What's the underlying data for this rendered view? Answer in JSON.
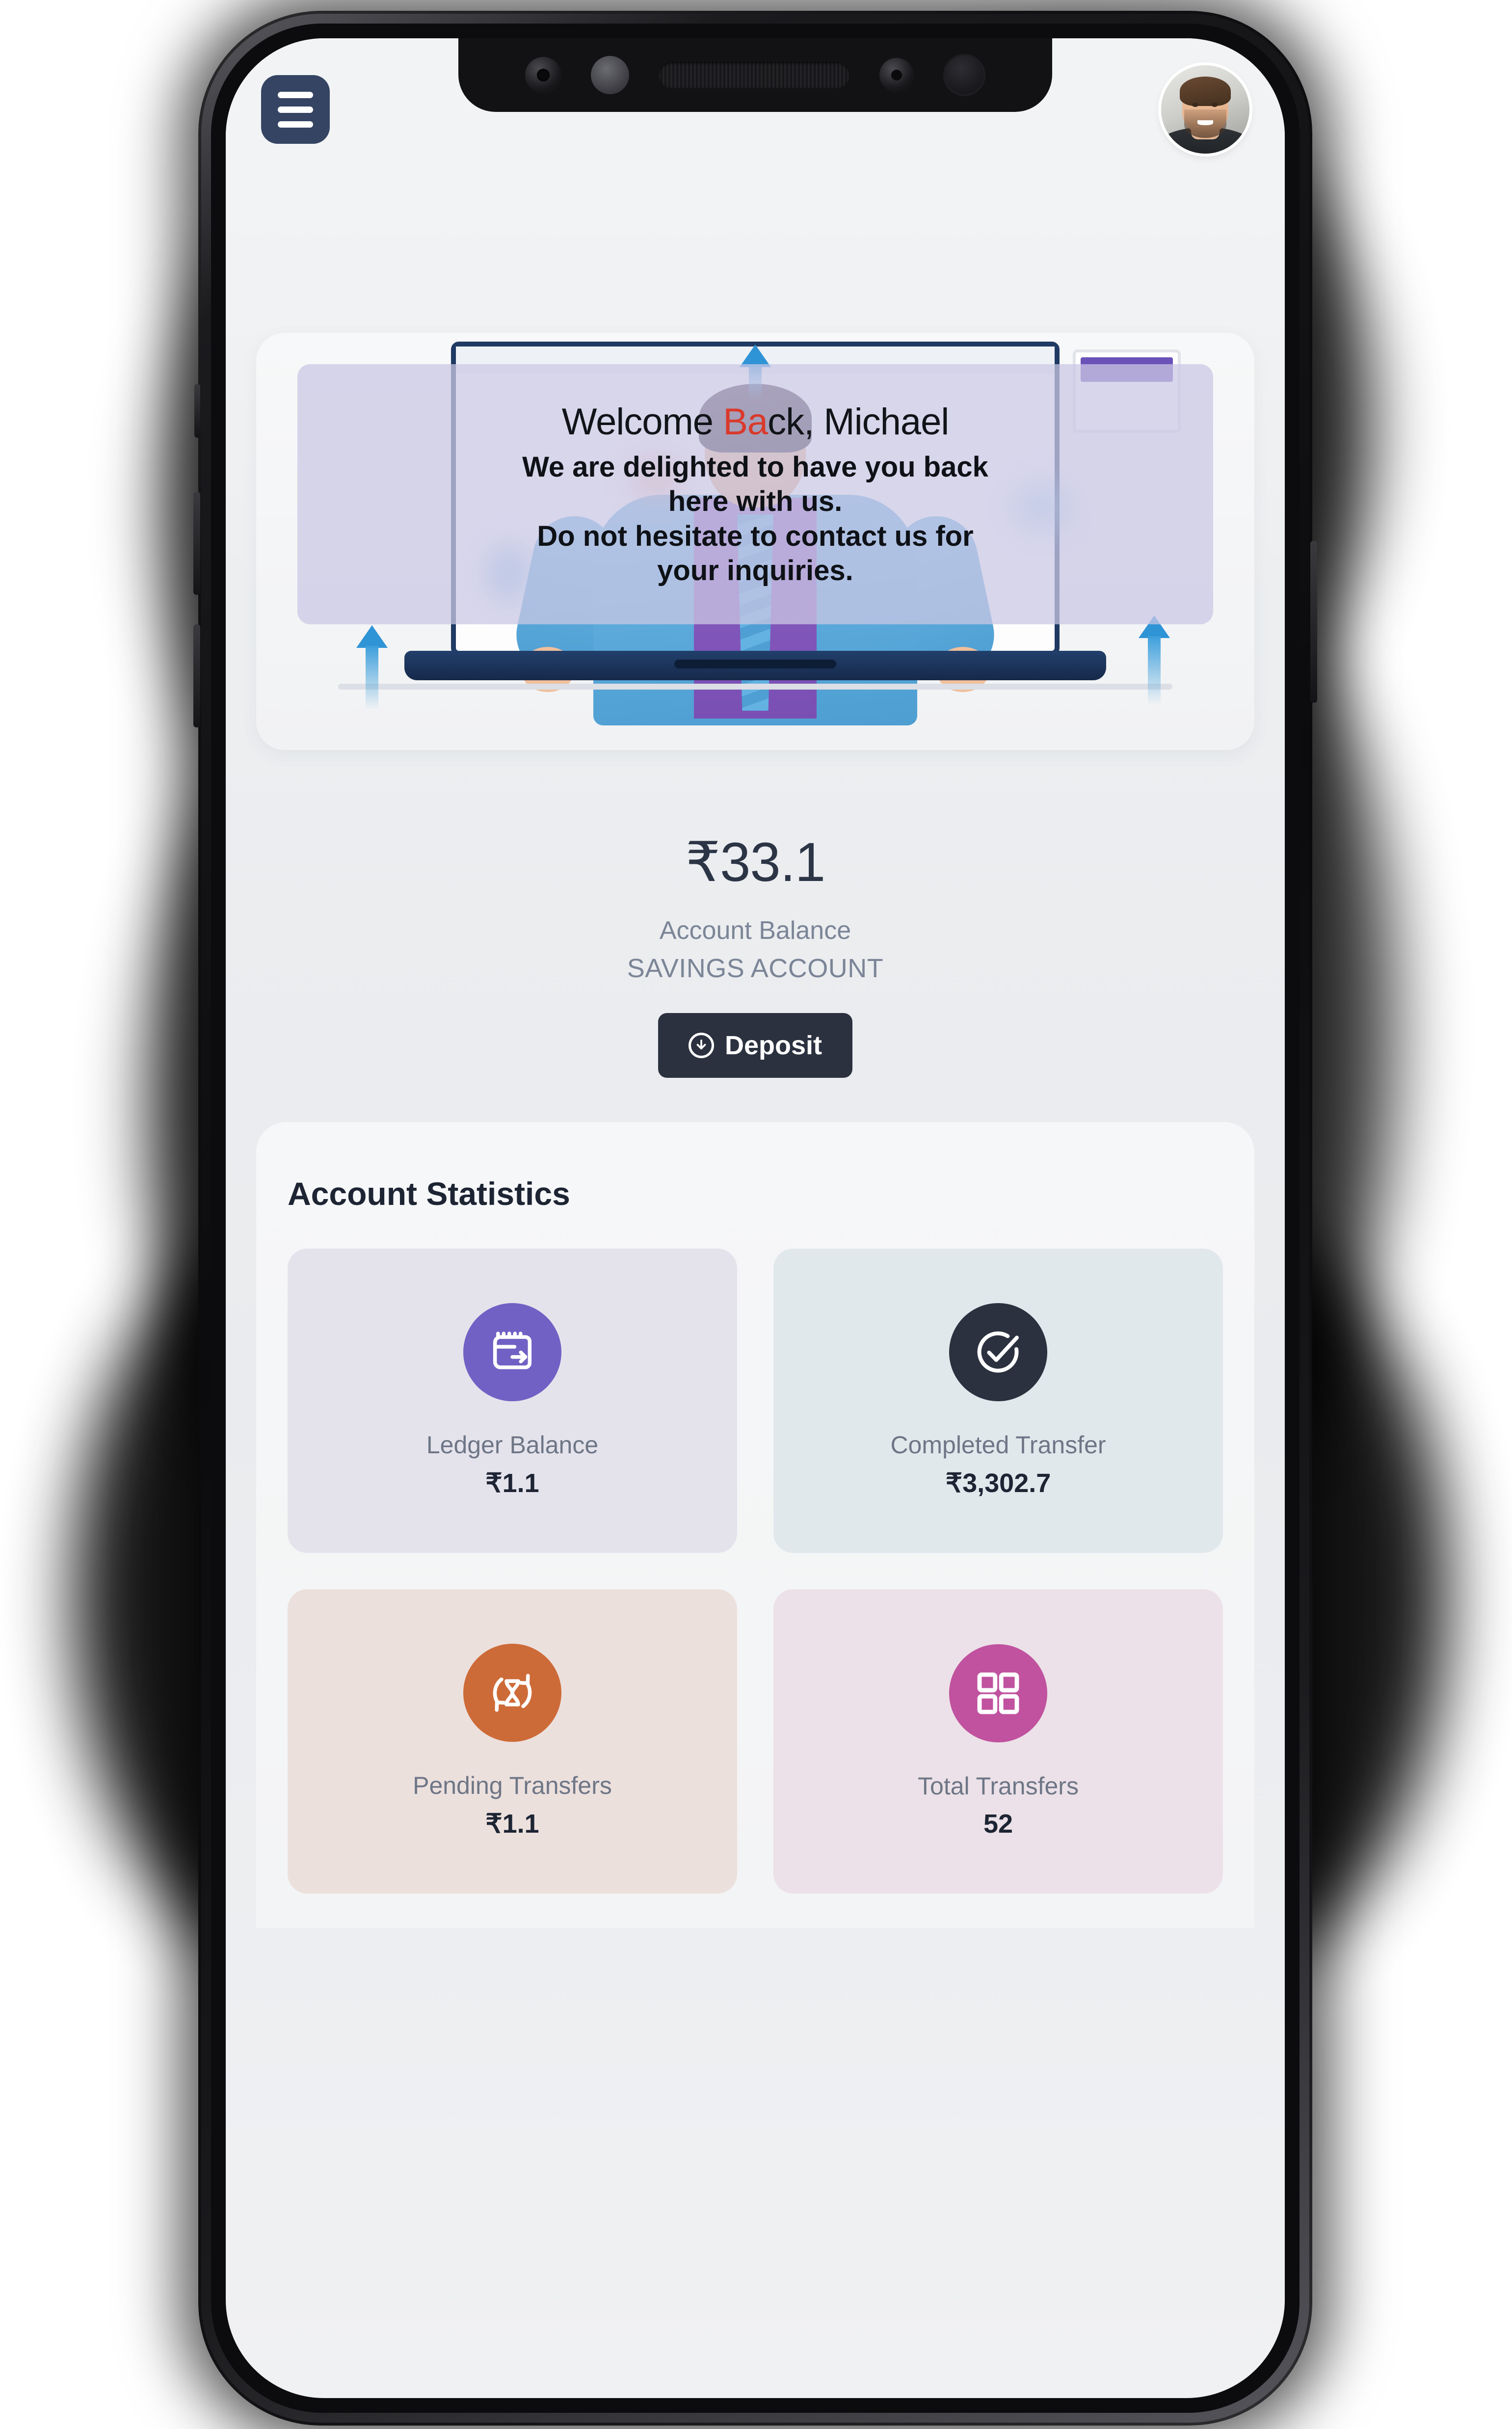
{
  "header": {
    "menu_icon": "hamburger-menu-icon",
    "avatar_alt": "user-avatar"
  },
  "welcome": {
    "title_prefix": "Welcome ",
    "title_highlight": "Ba",
    "title_suffix": "ck, Michael",
    "message_line1": "We are delighted to have you back",
    "message_line2": "here with us.",
    "message_line3": "Do not hesitate to contact us for",
    "message_line4": "your inquiries.",
    "overlay_color": "#cbc8e4"
  },
  "balance": {
    "amount": "₹33.1",
    "label": "Account Balance",
    "account_type": "SAVINGS ACCOUNT",
    "deposit_label": "Deposit",
    "deposit_icon": "download-circle-icon",
    "deposit_bg": "#2b313f"
  },
  "statistics": {
    "title": "Account Statistics",
    "cards": [
      {
        "label": "Ledger Balance",
        "value": "₹1.1",
        "icon": "wallet-arrow-icon",
        "icon_bg": "#7161c4",
        "card_bg": "#e4e3ec"
      },
      {
        "label": "Completed Transfer",
        "value": "₹3,302.7",
        "icon": "check-circle-icon",
        "icon_bg": "#2b313f",
        "card_bg": "#e1e8ec"
      },
      {
        "label": "Pending Transfers",
        "value": "₹1.1",
        "icon": "hourglass-refresh-icon",
        "icon_bg": "#cd6b38",
        "card_bg": "#ece0dd"
      },
      {
        "label": "Total Transfers",
        "value": "52",
        "icon": "grid-squares-icon",
        "icon_bg": "#c0529f",
        "card_bg": "#ece1e8"
      }
    ]
  }
}
